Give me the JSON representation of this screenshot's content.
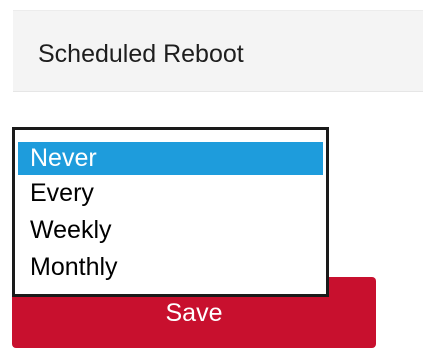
{
  "section": {
    "title": "Scheduled Reboot"
  },
  "reboot_select": {
    "selected": "Never",
    "options": [
      "Never",
      "Every",
      "Weekly",
      "Monthly"
    ]
  },
  "actions": {
    "save_label": "Save"
  },
  "colors": {
    "header_background": "#f4f4f4",
    "selected_option": "#1e9cdc",
    "save_button": "#c8102e"
  }
}
